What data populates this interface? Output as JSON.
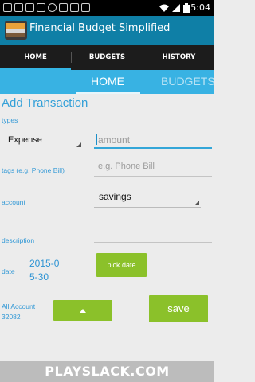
{
  "status_bar": {
    "time": "5:04"
  },
  "app": {
    "title": "Financial Budget Simplified"
  },
  "tabs": [
    {
      "label": "HOME"
    },
    {
      "label": "BUDGETS"
    },
    {
      "label": "HISTORY"
    }
  ],
  "sub_tabs": [
    {
      "label": "HOME"
    },
    {
      "label": "BUDGETS"
    }
  ],
  "form": {
    "title": "Add Transaction",
    "types_label": "types",
    "type_value": "Expense",
    "amount_placeholder": "amount",
    "tags_label": "tags (e.g. Phone Bill)",
    "tags_placeholder": "e.g. Phone Bill",
    "account_label": "account",
    "account_value": "savings",
    "description_label": "description",
    "date_label": "date",
    "date_line1": "2015-0",
    "date_line2": "5-30",
    "pick_date_label": "pick date",
    "all_account_label": "All Account",
    "all_account_value": "32082",
    "save_label": "save"
  },
  "watermark": {
    "text": "PLAYSLACK.COM"
  },
  "colors": {
    "action_bar": "#0f7fa6",
    "sub_tab_bar": "#38b2e3",
    "accent": "#33a0d8",
    "button": "#8bc12a"
  }
}
